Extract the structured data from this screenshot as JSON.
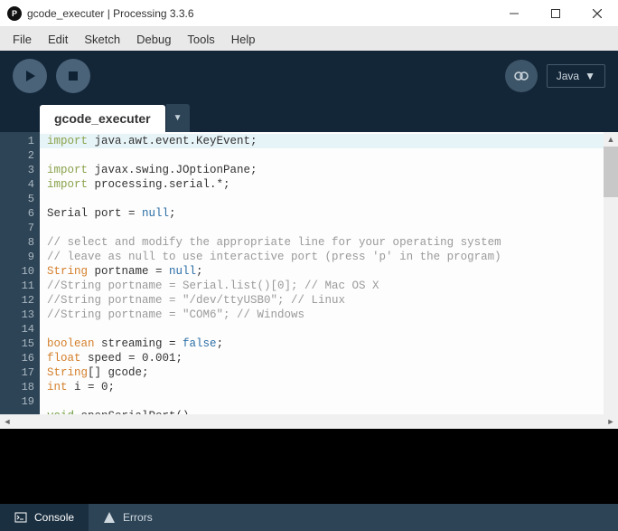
{
  "window": {
    "title": "gcode_executer | Processing 3.3.6",
    "app_glyph": "P"
  },
  "menu": [
    "File",
    "Edit",
    "Sketch",
    "Debug",
    "Tools",
    "Help"
  ],
  "toolbar": {
    "lang": "Java",
    "lang_arrow": "▼"
  },
  "tabs": {
    "active": "gcode_executer",
    "arrow": "▼"
  },
  "code": {
    "lines": [
      [
        [
          "kw-import",
          "import"
        ],
        [
          "",
          " java.awt.event.KeyEvent;"
        ]
      ],
      [
        [
          "kw-import",
          "import"
        ],
        [
          "",
          " javax.swing.JOptionPane;"
        ]
      ],
      [
        [
          "kw-import",
          "import"
        ],
        [
          "",
          " processing.serial.*;"
        ]
      ],
      [
        [
          "",
          ""
        ]
      ],
      [
        [
          "",
          "Serial port = "
        ],
        [
          "kw-null",
          "null"
        ],
        [
          "",
          ";"
        ]
      ],
      [
        [
          "",
          ""
        ]
      ],
      [
        [
          "cmt",
          "// select and modify the appropriate line for your operating system"
        ]
      ],
      [
        [
          "cmt",
          "// leave as null to use interactive port (press 'p' in the program)"
        ]
      ],
      [
        [
          "kw-type",
          "String"
        ],
        [
          "",
          " portname = "
        ],
        [
          "kw-null",
          "null"
        ],
        [
          "",
          ";"
        ]
      ],
      [
        [
          "cmt",
          "//String portname = Serial.list()[0]; // Mac OS X"
        ]
      ],
      [
        [
          "cmt",
          "//String portname = \"/dev/ttyUSB0\"; // Linux"
        ]
      ],
      [
        [
          "cmt",
          "//String portname = \"COM6\"; // Windows"
        ]
      ],
      [
        [
          "",
          ""
        ]
      ],
      [
        [
          "kw-type",
          "boolean"
        ],
        [
          "",
          " streaming = "
        ],
        [
          "kw-bool",
          "false"
        ],
        [
          "",
          ";"
        ]
      ],
      [
        [
          "kw-type",
          "float"
        ],
        [
          "",
          " speed = 0.001;"
        ]
      ],
      [
        [
          "kw-type",
          "String"
        ],
        [
          "",
          "[] gcode;"
        ]
      ],
      [
        [
          "kw-type",
          "int"
        ],
        [
          "",
          " i = 0;"
        ]
      ],
      [
        [
          "",
          ""
        ]
      ],
      [
        [
          "kw-void",
          "void"
        ],
        [
          "",
          " openSerialPort()"
        ]
      ]
    ]
  },
  "bottom": {
    "console": "Console",
    "errors": "Errors"
  }
}
